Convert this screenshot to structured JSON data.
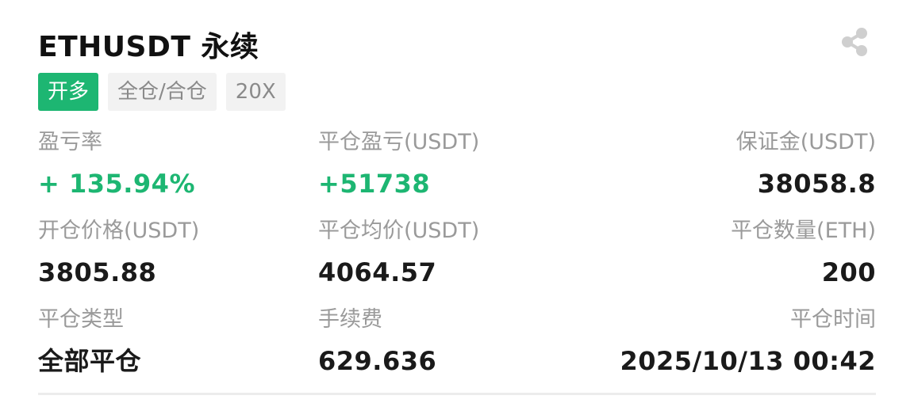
{
  "header": {
    "title": "ETHUSDT 永续",
    "share_icon": "share-icon"
  },
  "tags": {
    "direction": "开多",
    "margin_mode": "全仓/合仓",
    "leverage": "20X"
  },
  "stats": {
    "pnl_rate": {
      "label": "盈亏率",
      "value": "+ 135.94%"
    },
    "close_pnl": {
      "label": "平仓盈亏(USDT)",
      "value": "+51738"
    },
    "margin": {
      "label": "保证金(USDT)",
      "value": "38058.8"
    },
    "open_price": {
      "label": "开仓价格(USDT)",
      "value": "3805.88"
    },
    "close_avg_price": {
      "label": "平仓均价(USDT)",
      "value": "4064.57"
    },
    "close_qty": {
      "label": "平仓数量(ETH)",
      "value": "200"
    },
    "close_type": {
      "label": "平仓类型",
      "value": "全部平仓"
    },
    "fee": {
      "label": "手续费",
      "value": "629.636"
    },
    "close_time": {
      "label": "平仓时间",
      "value": "2025/10/13 00:42"
    }
  },
  "colors": {
    "profit_green": "#1db672",
    "label_gray": "#9a9a9a",
    "tag_gray_bg": "#f2f2f2"
  }
}
